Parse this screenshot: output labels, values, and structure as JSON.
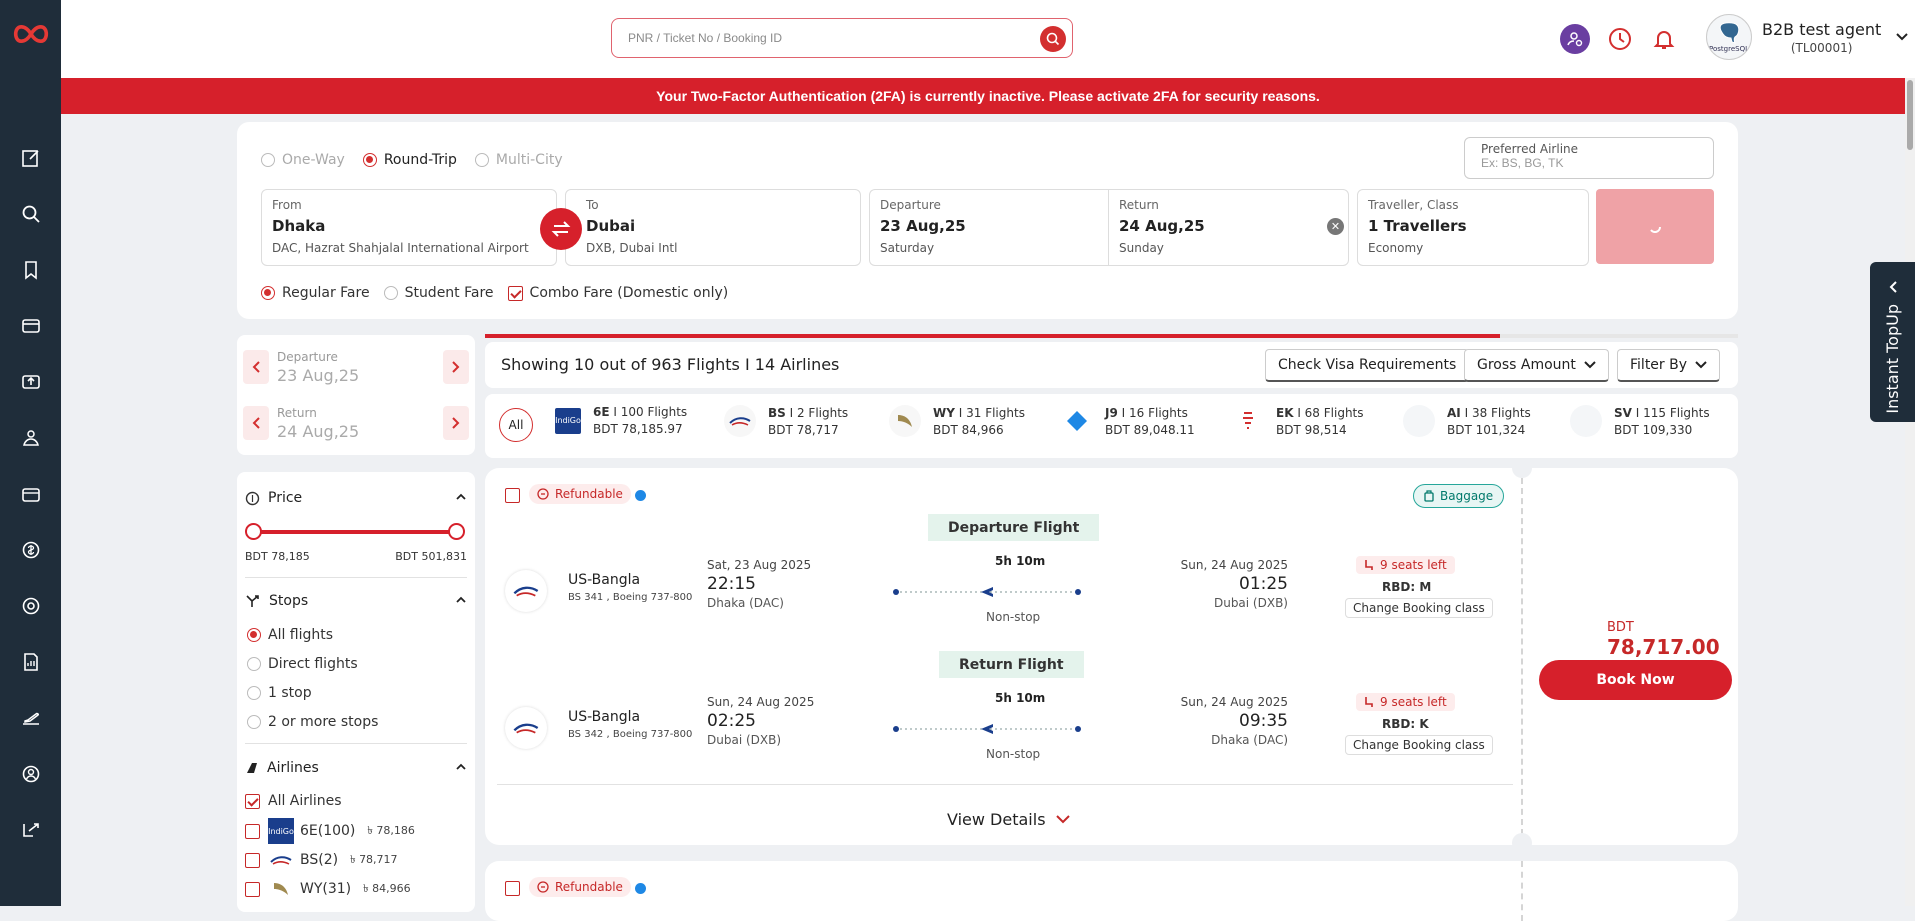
{
  "sidebar": {
    "items": [
      "edit-icon",
      "search-icon",
      "bookmark-icon",
      "card-icon",
      "upload-icon",
      "group-icon",
      "wallet-icon",
      "coin-icon",
      "support-icon",
      "report-icon",
      "flight-icon",
      "account-icon",
      "logout-icon"
    ]
  },
  "topbar": {
    "search_placeholder": "PNR / Ticket No / Booking ID",
    "user_name": "B2B test agent",
    "user_code": "(TL00001)",
    "avatar_text": "PostgreSQL"
  },
  "banner": {
    "text": "Your Two-Factor Authentication (2FA) is currently inactive. Please activate 2FA for security reasons."
  },
  "search": {
    "trip_types": [
      {
        "label": "One-Way",
        "selected": false
      },
      {
        "label": "Round-Trip",
        "selected": true
      },
      {
        "label": "Multi-City",
        "selected": false
      }
    ],
    "preferred_airline_label": "Preferred Airline",
    "preferred_airline_placeholder": "Ex: BS, BG, TK",
    "from": {
      "label": "From",
      "city": "Dhaka",
      "airport": "DAC, Hazrat Shahjalal International Airport"
    },
    "to": {
      "label": "To",
      "city": "Dubai",
      "airport": "DXB, Dubai Intl"
    },
    "departure": {
      "label": "Departure",
      "date": "23 Aug,25",
      "day": "Saturday"
    },
    "return": {
      "label": "Return",
      "date": "24 Aug,25",
      "day": "Sunday"
    },
    "traveller": {
      "label": "Traveller, Class",
      "value": "1 Travellers",
      "class": "Economy"
    },
    "fares": [
      {
        "label": "Regular Fare",
        "selected": true
      },
      {
        "label": "Student Fare",
        "selected": false
      },
      {
        "label": "Combo Fare (Domestic only)",
        "checked": true
      }
    ]
  },
  "datenav": {
    "departure_label": "Departure",
    "departure_date": "23 Aug,25",
    "return_label": "Return",
    "return_date": "24 Aug,25"
  },
  "filters": {
    "price": {
      "title": "Price",
      "min": "BDT 78,185",
      "max": "BDT 501,831"
    },
    "stops": {
      "title": "Stops",
      "options": [
        {
          "label": "All flights",
          "selected": true
        },
        {
          "label": "Direct flights",
          "selected": false
        },
        {
          "label": "1 stop",
          "selected": false
        },
        {
          "label": "2 or more stops",
          "selected": false
        }
      ]
    },
    "airlines": {
      "title": "Airlines",
      "all_label": "All Airlines",
      "items": [
        {
          "label": "6E(100)",
          "price": "78,186"
        },
        {
          "label": "BS(2)",
          "price": "78,717"
        },
        {
          "label": "WY(31)",
          "price": "84,966"
        }
      ]
    }
  },
  "results": {
    "progress": 0.81,
    "count_text": "Showing 10 out of 963 Flights I 14 Airlines",
    "visa_button": "Check Visa Requirements",
    "gross_button": "Gross Amount",
    "filter_button": "Filter By"
  },
  "airline_strip": {
    "all_label": "All",
    "items": [
      {
        "code": "6E",
        "flights": "100 Flights",
        "price": "BDT 78,185.97"
      },
      {
        "code": "BS",
        "flights": "2 Flights",
        "price": "BDT 78,717"
      },
      {
        "code": "WY",
        "flights": "31 Flights",
        "price": "BDT 84,966"
      },
      {
        "code": "J9",
        "flights": "16 Flights",
        "price": "BDT 89,048.11"
      },
      {
        "code": "EK",
        "flights": "68 Flights",
        "price": "BDT 98,514"
      },
      {
        "code": "AI",
        "flights": "38 Flights",
        "price": "BDT 101,324"
      },
      {
        "code": "SV",
        "flights": "115 Flights",
        "price": "BDT 109,330"
      }
    ]
  },
  "card": {
    "refundable": "Refundable",
    "baggage": "Baggage",
    "departure_title": "Departure Flight",
    "return_title": "Return Flight",
    "legs": [
      {
        "airline": "US-Bangla",
        "flight": "BS 341 , Boeing 737-800",
        "dep_date": "Sat, 23 Aug 2025",
        "dep_time": "22:15",
        "dep_airport": "Dhaka (DAC)",
        "duration": "5h 10m",
        "stops": "Non-stop",
        "arr_date": "Sun, 24 Aug 2025",
        "arr_time": "01:25",
        "arr_airport": "Dubai (DXB)",
        "seats": "9 seats left",
        "rbd": "RBD: M",
        "change": "Change Booking class"
      },
      {
        "airline": "US-Bangla",
        "flight": "BS 342 , Boeing 737-800",
        "dep_date": "Sun, 24 Aug 2025",
        "dep_time": "02:25",
        "dep_airport": "Dubai (DXB)",
        "duration": "5h 10m",
        "stops": "Non-stop",
        "arr_date": "Sun, 24 Aug 2025",
        "arr_time": "09:35",
        "arr_airport": "Dhaka (DAC)",
        "seats": "9 seats left",
        "rbd": "RBD: K",
        "change": "Change Booking class"
      }
    ],
    "view_details": "View Details",
    "currency": "BDT",
    "price": "78,717.00",
    "book_now": "Book Now"
  },
  "topup": {
    "label": "Instant TopUp"
  },
  "colors": {
    "brand": "#d6202b",
    "sidebar": "#1f2d3a"
  }
}
